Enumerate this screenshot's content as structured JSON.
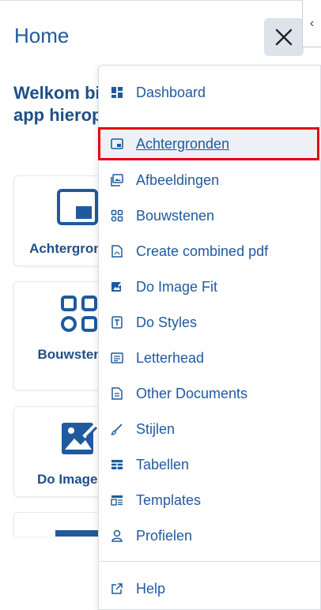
{
  "header": {
    "title": "Home"
  },
  "welcome": {
    "line1": "Welkom bij de",
    "line2": "app hierop"
  },
  "tiles": [
    {
      "label": "Achtergronden"
    },
    {
      "label": "Bouwstenen"
    },
    {
      "label": "Do Image Fit"
    },
    {
      "label": ""
    }
  ],
  "menu": {
    "items": [
      {
        "label": "Dashboard",
        "icon": "dashboard-icon"
      },
      {
        "label": "Achtergronden",
        "icon": "background-icon",
        "active": true
      },
      {
        "label": "Afbeeldingen",
        "icon": "images-icon"
      },
      {
        "label": "Bouwstenen",
        "icon": "blocks-icon"
      },
      {
        "label": "Create combined pdf",
        "icon": "pdf-icon"
      },
      {
        "label": "Do Image Fit",
        "icon": "image-fit-icon"
      },
      {
        "label": "Do Styles",
        "icon": "styles-icon"
      },
      {
        "label": "Letterhead",
        "icon": "letterhead-icon"
      },
      {
        "label": "Other Documents",
        "icon": "document-icon"
      },
      {
        "label": "Stijlen",
        "icon": "brush-icon"
      },
      {
        "label": "Tabellen",
        "icon": "table-icon"
      },
      {
        "label": "Templates",
        "icon": "templates-icon"
      },
      {
        "label": "Profielen",
        "icon": "user-icon"
      }
    ],
    "help": {
      "label": "Help",
      "icon": "external-link-icon"
    }
  },
  "colors": {
    "primary": "#1f5a9e",
    "highlight": "#e8000f",
    "active_bg": "#edf1f5"
  }
}
